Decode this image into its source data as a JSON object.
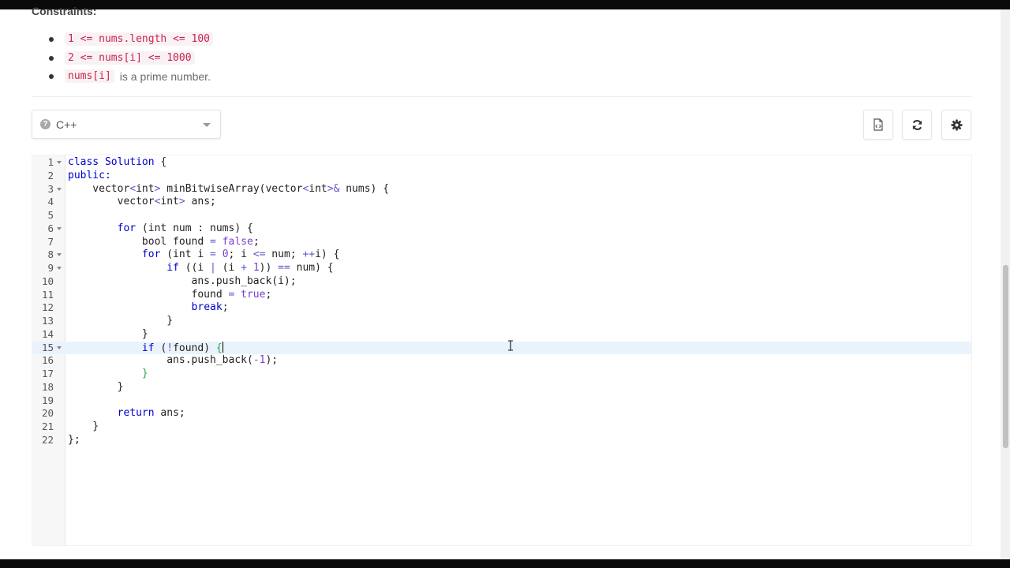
{
  "constraints": {
    "heading": "Constraints:",
    "items": [
      {
        "code": "1 <= nums.length <= 100",
        "text": ""
      },
      {
        "code": "2 <= nums[i] <= 1000",
        "text": ""
      },
      {
        "code": "nums[i]",
        "text": "is a prime number."
      }
    ]
  },
  "toolbar": {
    "language": "C++",
    "help_glyph": "?",
    "buttons": [
      {
        "name": "code-file-icon"
      },
      {
        "name": "refresh-icon"
      },
      {
        "name": "settings-gear-icon"
      }
    ]
  },
  "editor": {
    "active_line": 15,
    "lines": [
      {
        "n": "1",
        "fold": true
      },
      {
        "n": "2",
        "fold": false
      },
      {
        "n": "3",
        "fold": true
      },
      {
        "n": "4",
        "fold": false
      },
      {
        "n": "5",
        "fold": false
      },
      {
        "n": "6",
        "fold": true
      },
      {
        "n": "7",
        "fold": false
      },
      {
        "n": "8",
        "fold": true
      },
      {
        "n": "9",
        "fold": true
      },
      {
        "n": "10",
        "fold": false
      },
      {
        "n": "11",
        "fold": false
      },
      {
        "n": "12",
        "fold": false
      },
      {
        "n": "13",
        "fold": false
      },
      {
        "n": "14",
        "fold": false
      },
      {
        "n": "15",
        "fold": true
      },
      {
        "n": "16",
        "fold": false
      },
      {
        "n": "17",
        "fold": false
      },
      {
        "n": "18",
        "fold": false
      },
      {
        "n": "19",
        "fold": false
      },
      {
        "n": "20",
        "fold": false
      },
      {
        "n": "21",
        "fold": false
      },
      {
        "n": "22",
        "fold": false
      }
    ],
    "code": [
      [
        [
          "kw",
          "class"
        ],
        [
          "t",
          " "
        ],
        [
          "kw",
          "Solution"
        ],
        [
          "t",
          " {"
        ]
      ],
      [
        [
          "kw",
          "public"
        ],
        [
          "kw",
          ":"
        ]
      ],
      [
        [
          "t",
          "    vector"
        ],
        [
          "op",
          "<"
        ],
        [
          "t",
          "int"
        ],
        [
          "op",
          ">"
        ],
        [
          "t",
          " minBitwiseArray(vector"
        ],
        [
          "op",
          "<"
        ],
        [
          "t",
          "int"
        ],
        [
          "op",
          ">&"
        ],
        [
          "t",
          " nums) {"
        ]
      ],
      [
        [
          "t",
          "        vector"
        ],
        [
          "op",
          "<"
        ],
        [
          "t",
          "int"
        ],
        [
          "op",
          ">"
        ],
        [
          "t",
          " ans;"
        ]
      ],
      [
        [
          "t",
          ""
        ]
      ],
      [
        [
          "t",
          "        "
        ],
        [
          "kw",
          "for"
        ],
        [
          "t",
          " (int num : nums) {"
        ]
      ],
      [
        [
          "t",
          "            bool found "
        ],
        [
          "op",
          "="
        ],
        [
          "t",
          " "
        ],
        [
          "cn",
          "false"
        ],
        [
          "t",
          ";"
        ]
      ],
      [
        [
          "t",
          "            "
        ],
        [
          "kw",
          "for"
        ],
        [
          "t",
          " (int i "
        ],
        [
          "op",
          "="
        ],
        [
          "t",
          " "
        ],
        [
          "cn",
          "0"
        ],
        [
          "t",
          "; i "
        ],
        [
          "op",
          "<="
        ],
        [
          "t",
          " num; "
        ],
        [
          "op",
          "++"
        ],
        [
          "t",
          "i) {"
        ]
      ],
      [
        [
          "t",
          "                "
        ],
        [
          "kw",
          "if"
        ],
        [
          "t",
          " ((i "
        ],
        [
          "op",
          "|"
        ],
        [
          "t",
          " (i "
        ],
        [
          "op",
          "+"
        ],
        [
          "t",
          " "
        ],
        [
          "cn",
          "1"
        ],
        [
          "t",
          ")) "
        ],
        [
          "op",
          "=="
        ],
        [
          "t",
          " num) {"
        ]
      ],
      [
        [
          "t",
          "                    ans.push_back(i);"
        ]
      ],
      [
        [
          "t",
          "                    found "
        ],
        [
          "op",
          "="
        ],
        [
          "t",
          " "
        ],
        [
          "cn",
          "true"
        ],
        [
          "t",
          ";"
        ]
      ],
      [
        [
          "t",
          "                    "
        ],
        [
          "kw",
          "break"
        ],
        [
          "t",
          ";"
        ]
      ],
      [
        [
          "t",
          "                }"
        ]
      ],
      [
        [
          "t",
          "            }"
        ]
      ],
      [
        [
          "t",
          "            "
        ],
        [
          "kw",
          "if"
        ],
        [
          "t",
          " ("
        ],
        [
          "op",
          "!"
        ],
        [
          "t",
          "found) "
        ],
        [
          "br",
          "{"
        ],
        [
          "cursor",
          ""
        ]
      ],
      [
        [
          "t",
          "                ans.push_back("
        ],
        [
          "op",
          "-"
        ],
        [
          "cn",
          "1"
        ],
        [
          "t",
          ");"
        ]
      ],
      [
        [
          "t",
          "            "
        ],
        [
          "br",
          "}"
        ]
      ],
      [
        [
          "t",
          "        }"
        ]
      ],
      [
        [
          "t",
          ""
        ]
      ],
      [
        [
          "t",
          "        "
        ],
        [
          "kw",
          "return"
        ],
        [
          "t",
          " ans;"
        ]
      ],
      [
        [
          "t",
          "    }"
        ]
      ],
      [
        [
          "t",
          "};"
        ]
      ]
    ]
  }
}
